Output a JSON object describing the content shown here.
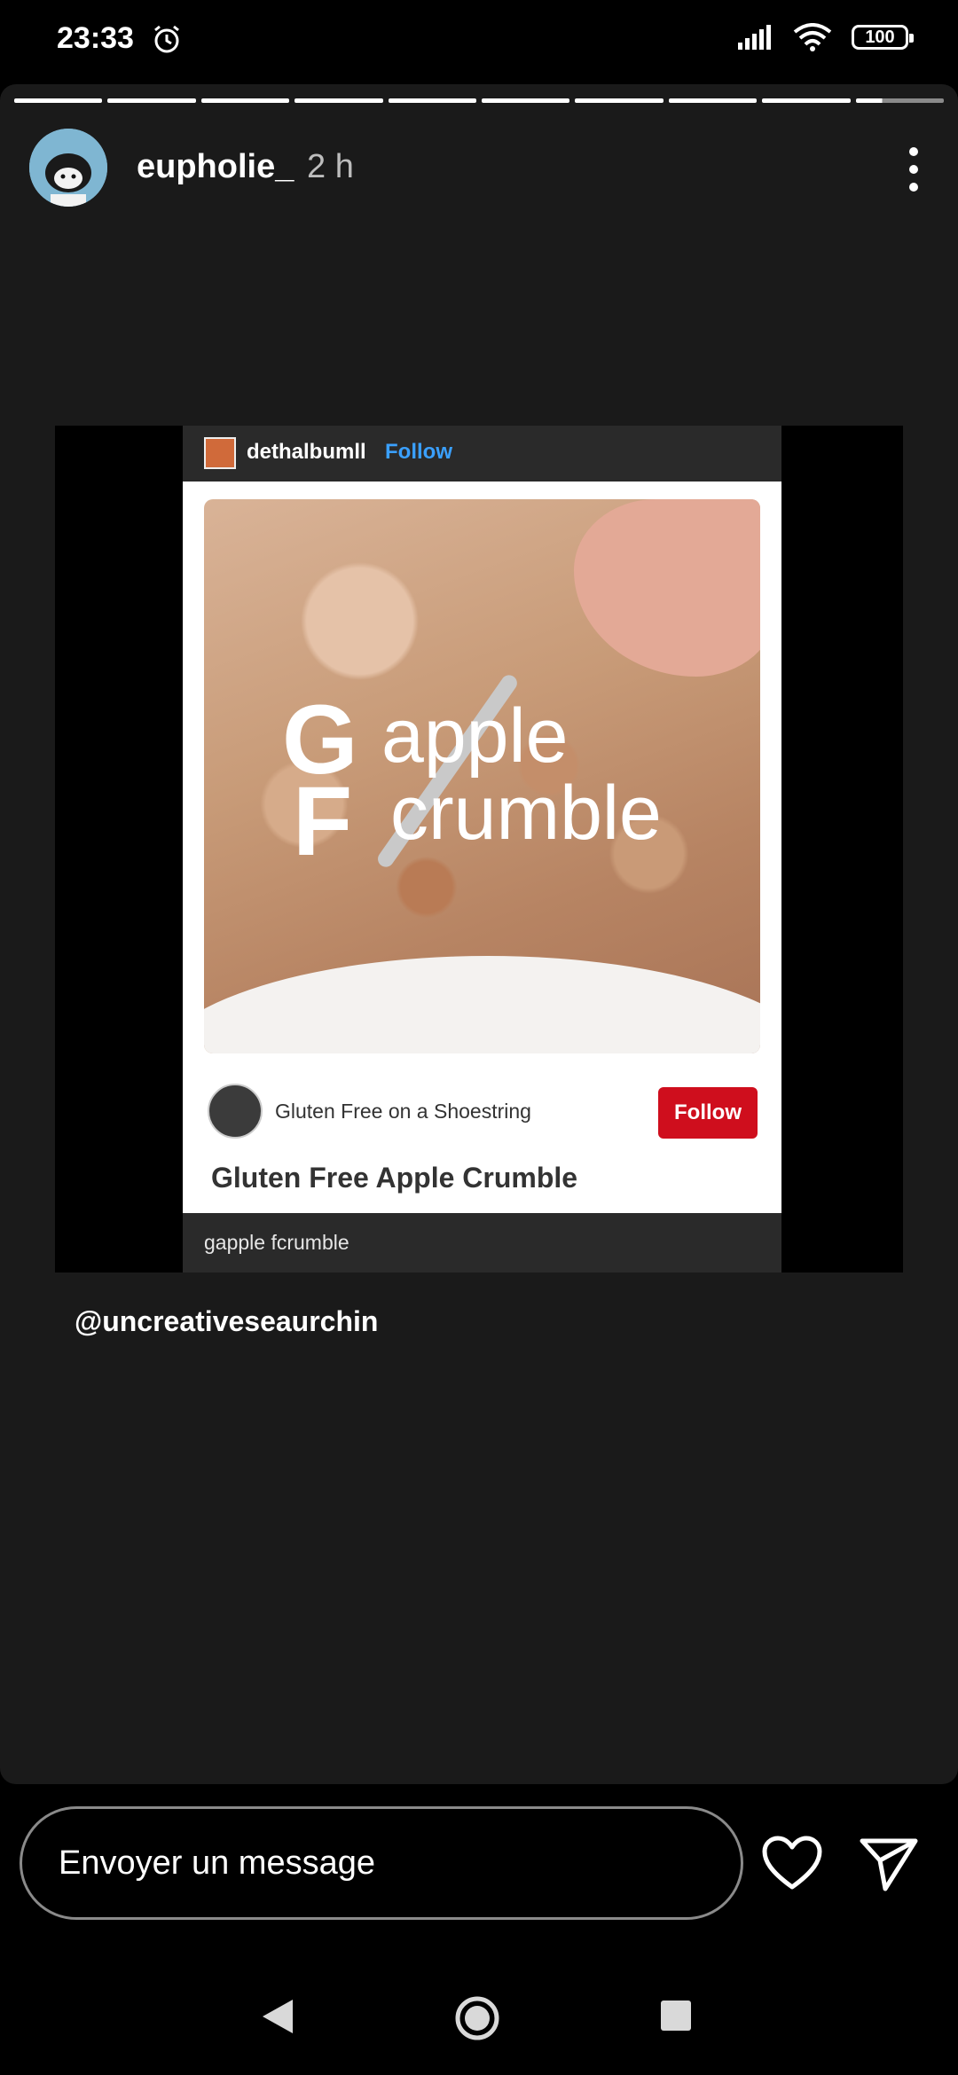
{
  "status_bar": {
    "time": "23:33",
    "battery": "100"
  },
  "story": {
    "progress_segments": 10,
    "current_segment_progress": 0.3,
    "username": "eupholie_",
    "time_ago": "2 h",
    "mention": "@uncreativeseaurchin"
  },
  "shared_post": {
    "username": "dethalbumll",
    "follow_label": "Follow",
    "image_text": {
      "letter_g": "G",
      "word_1": "apple",
      "letter_f": "F",
      "word_2": "crumble"
    },
    "author": "Gluten Free on a Shoestring",
    "author_follow": "Follow",
    "title": "Gluten Free Apple Crumble",
    "caption": "gapple fcrumble"
  },
  "reply": {
    "placeholder": "Envoyer un message"
  },
  "colors": {
    "pin_red": "#cf0e1d",
    "link_blue": "#3aa0ff",
    "story_bg": "#1a1a1a"
  }
}
